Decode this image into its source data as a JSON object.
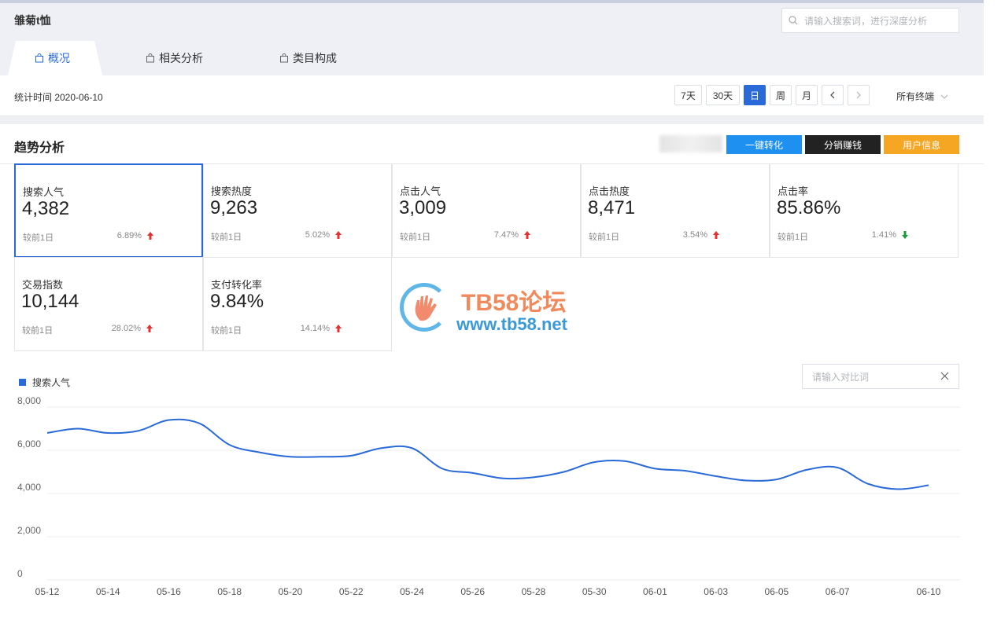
{
  "header": {
    "title": "雏菊t恤",
    "search_placeholder": "请输入搜索词，进行深度分析"
  },
  "tabs": [
    {
      "label": "概况",
      "active": true
    },
    {
      "label": "相关分析",
      "active": false
    },
    {
      "label": "类目构成",
      "active": false
    }
  ],
  "stat_bar": {
    "time_label": "统计时间 2020-06-10",
    "ranges": [
      "7天",
      "30天",
      "日",
      "周",
      "月"
    ],
    "active_range": "日",
    "terminal": "所有终端"
  },
  "trend": {
    "title": "趋势分析",
    "actions": [
      {
        "label": "一键转化",
        "color": "#1e90f0"
      },
      {
        "label": "分销赚钱",
        "color": "#222222"
      },
      {
        "label": "用户信息",
        "color": "#f5a623"
      }
    ],
    "cards": [
      {
        "label": "搜索人气",
        "value": "4,382",
        "compare": "较前1日",
        "pct": "6.89%",
        "dir": "up",
        "selected": true
      },
      {
        "label": "搜索热度",
        "value": "9,263",
        "compare": "较前1日",
        "pct": "5.02%",
        "dir": "up"
      },
      {
        "label": "点击人气",
        "value": "3,009",
        "compare": "较前1日",
        "pct": "7.47%",
        "dir": "up"
      },
      {
        "label": "点击热度",
        "value": "8,471",
        "compare": "较前1日",
        "pct": "3.54%",
        "dir": "up"
      },
      {
        "label": "点击率",
        "value": "85.86%",
        "compare": "较前1日",
        "pct": "1.41%",
        "dir": "down"
      },
      {
        "label": "交易指数",
        "value": "10,144",
        "compare": "较前1日",
        "pct": "28.02%",
        "dir": "up"
      },
      {
        "label": "支付转化率",
        "value": "9.84%",
        "compare": "较前1日",
        "pct": "14.14%",
        "dir": "up"
      }
    ],
    "compare_placeholder": "请输入对比词"
  },
  "watermark": {
    "line1": "TB58论坛",
    "line2": "www.tb58.net"
  },
  "colors": {
    "accent": "#2a6ad8",
    "up": "#e5302d",
    "down": "#1a9a3a"
  },
  "chart_data": {
    "type": "line",
    "series": [
      {
        "name": "搜索人气",
        "x": [
          "05-12",
          "05-13",
          "05-14",
          "05-15",
          "05-16",
          "05-17",
          "05-18",
          "05-19",
          "05-20",
          "05-21",
          "05-22",
          "05-23",
          "05-24",
          "05-25",
          "05-26",
          "05-27",
          "05-28",
          "05-29",
          "05-30",
          "05-31",
          "06-01",
          "06-02",
          "06-03",
          "06-04",
          "06-05",
          "06-06",
          "06-07",
          "06-08",
          "06-09",
          "06-10"
        ],
        "values": [
          6800,
          7000,
          6800,
          6900,
          7400,
          7250,
          6250,
          5900,
          5700,
          5700,
          5750,
          6100,
          6100,
          5150,
          4950,
          4700,
          4750,
          5000,
          5450,
          5500,
          5150,
          5050,
          4800,
          4600,
          4650,
          5100,
          5200,
          4450,
          4200,
          4380
        ]
      }
    ],
    "xticks": [
      "05-12",
      "05-14",
      "05-16",
      "05-18",
      "05-20",
      "05-22",
      "05-24",
      "05-26",
      "05-28",
      "05-30",
      "06-01",
      "06-03",
      "06-05",
      "06-07",
      "06-10"
    ],
    "yticks": [
      "0",
      "2,000",
      "4,000",
      "6,000",
      "8,000"
    ],
    "ylim": [
      0,
      8000
    ],
    "grid": true,
    "legend": "top-left"
  }
}
